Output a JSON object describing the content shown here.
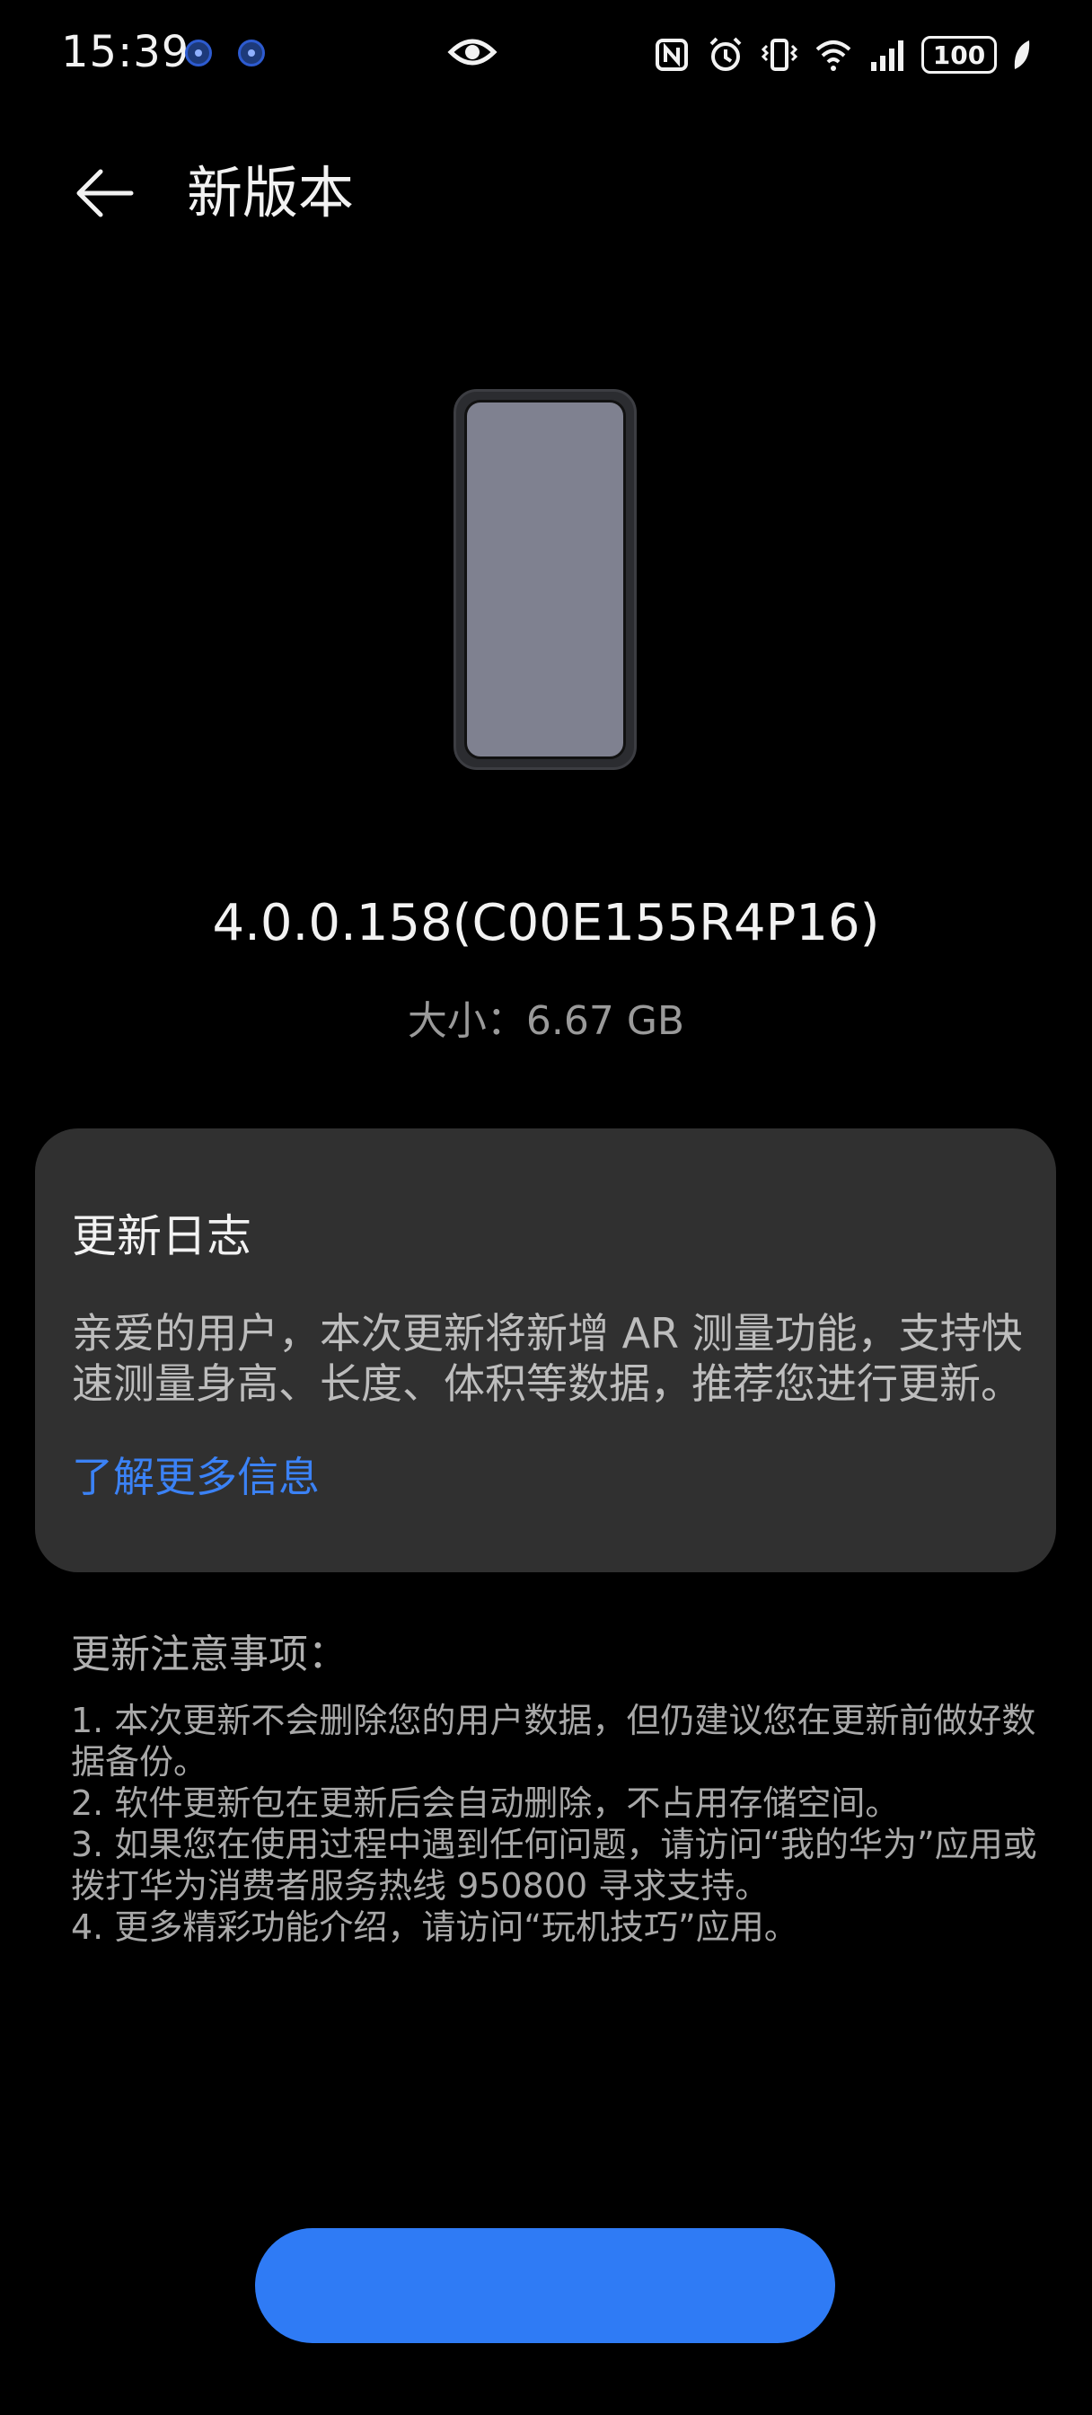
{
  "status_bar": {
    "time": "15:39",
    "battery": "100",
    "icons": [
      "nfc-icon",
      "alarm-icon",
      "vibrate-icon",
      "wifi-icon",
      "signal-icon",
      "battery-icon",
      "leaf-icon"
    ]
  },
  "header": {
    "title": "新版本",
    "back_icon": "arrow-left-icon"
  },
  "update": {
    "version": "4.0.0.158(C00E155R4P16)",
    "size_label": "大小：",
    "size_value": "6.67 GB"
  },
  "changelog": {
    "title": "更新日志",
    "body": "亲爱的用户，本次更新将新增 AR 测量功能，支持快速测量身高、长度、体积等数据，推荐您进行更新。",
    "link": "了解更多信息"
  },
  "notes": {
    "title": "更新注意事项：",
    "items": [
      "1. 本次更新不会删除您的用户数据，但仍建议您在更新前做好数据备份。",
      "2. 软件更新包在更新后会自动删除，不占用存储空间。",
      "3. 如果您在使用过程中遇到任何问题，请访问“我的华为”应用或拨打华为消费者服务热线 950800 寻求支持。",
      "4. 更多精彩功能介绍，请访问“玩机技巧”应用。"
    ]
  },
  "colors": {
    "background": "#000000",
    "card": "#303030",
    "accent": "#3b82f6",
    "button": "#2f7bf5"
  }
}
